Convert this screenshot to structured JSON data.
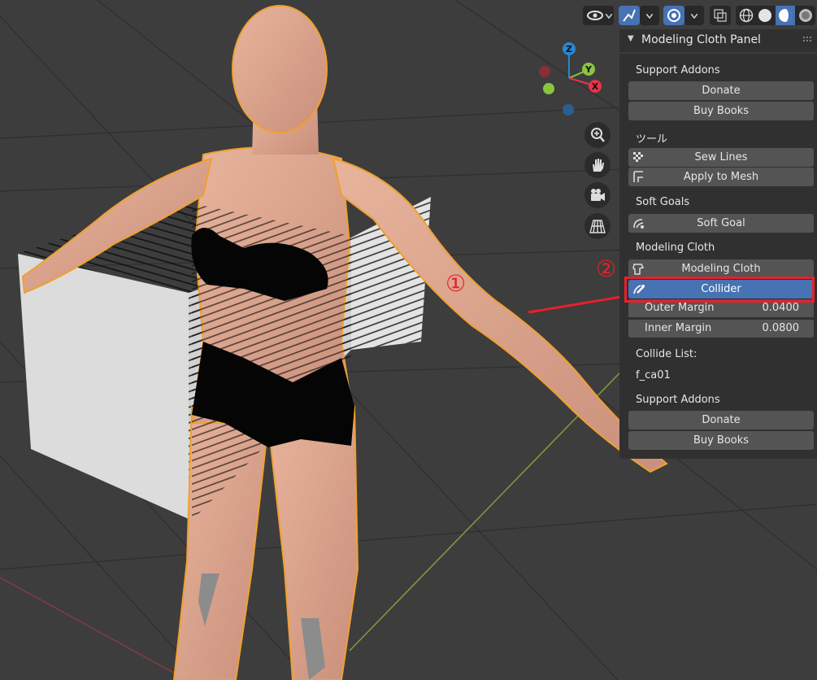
{
  "header": {
    "icons": [
      "eye-icon",
      "gizmo-icon",
      "overlay-icon",
      "xray-icon",
      "wireframe-shading-icon",
      "solid-shading-icon",
      "material-shading-icon",
      "rendered-shading-icon"
    ]
  },
  "gizmo": {
    "axes": {
      "z": "Z",
      "y": "Y",
      "x": "X"
    },
    "colors": {
      "x": "#e8334a",
      "y": "#8bc53f",
      "z": "#2a86d4"
    }
  },
  "nav_buttons": [
    "zoom-icon",
    "hand-pan-icon",
    "camera-icon",
    "grid-perspective-icon"
  ],
  "panel": {
    "title": "Modeling Cloth Panel",
    "support1": {
      "label": "Support Addons",
      "donate": "Donate",
      "buy": "Buy Books"
    },
    "tools": {
      "label": "ツール",
      "sew": "Sew Lines",
      "apply": "Apply to Mesh"
    },
    "soft_goals": {
      "label": "Soft Goals",
      "soft_goal": "Soft Goal"
    },
    "modeling_cloth": {
      "label": "Modeling Cloth",
      "button": "Modeling Cloth",
      "collider": "Collider",
      "outer_margin_label": "Outer Margin",
      "outer_margin_value": "0.0400",
      "inner_margin_label": "Inner Margin",
      "inner_margin_value": "0.0800"
    },
    "collide_list": {
      "label": "Collide List:",
      "item": "f_ca01"
    },
    "support2": {
      "label": "Support Addons",
      "donate": "Donate",
      "buy": "Buy Books"
    }
  },
  "annotations": {
    "one": "①",
    "two": "②",
    "color": "#e8202a"
  }
}
